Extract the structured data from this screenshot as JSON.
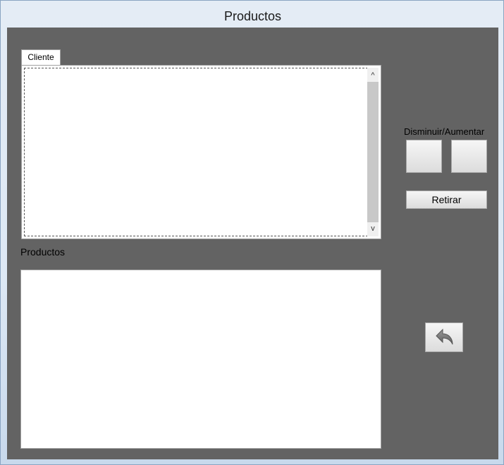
{
  "window": {
    "title": "Productos"
  },
  "cliente_tab": {
    "label": "Cliente"
  },
  "productos_section": {
    "label": "Productos"
  },
  "controls": {
    "adjust_label": "Disminuir/Aumentar",
    "retirar_label": "Retirar"
  },
  "icons": {
    "back": "undo-arrow-icon",
    "scroll_up": "chevron-up-icon",
    "scroll_down": "chevron-down-icon"
  }
}
